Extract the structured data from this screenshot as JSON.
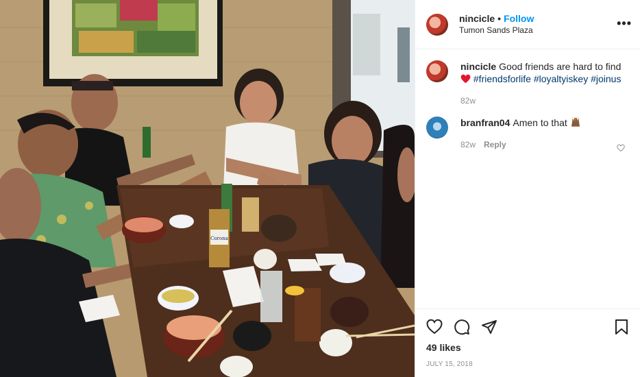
{
  "header": {
    "username": "nincicle",
    "separator": "•",
    "follow_label": "Follow",
    "location": "Tumon Sands Plaza",
    "more_label": "•••"
  },
  "caption": {
    "username": "nincicle",
    "text": "Good friends are hard to find",
    "heart_emoji": "red-heart-emoji",
    "tags": [
      "#friendsforlife",
      "#loyaltyiskey",
      "#joinus"
    ],
    "age": "82w"
  },
  "comments": [
    {
      "username": "branfran04",
      "text": "Amen to that",
      "emoji": "raised-hands-emoji",
      "age": "82w",
      "reply_label": "Reply"
    }
  ],
  "footer": {
    "likes": "49 likes",
    "date": "JULY 15, 2018"
  },
  "photo": {
    "bottle_label": "Corona"
  },
  "colors": {
    "accent": "#0095f6",
    "hashtag": "#00376b",
    "muted": "#8e8e8e",
    "heart": "#ed4956"
  }
}
